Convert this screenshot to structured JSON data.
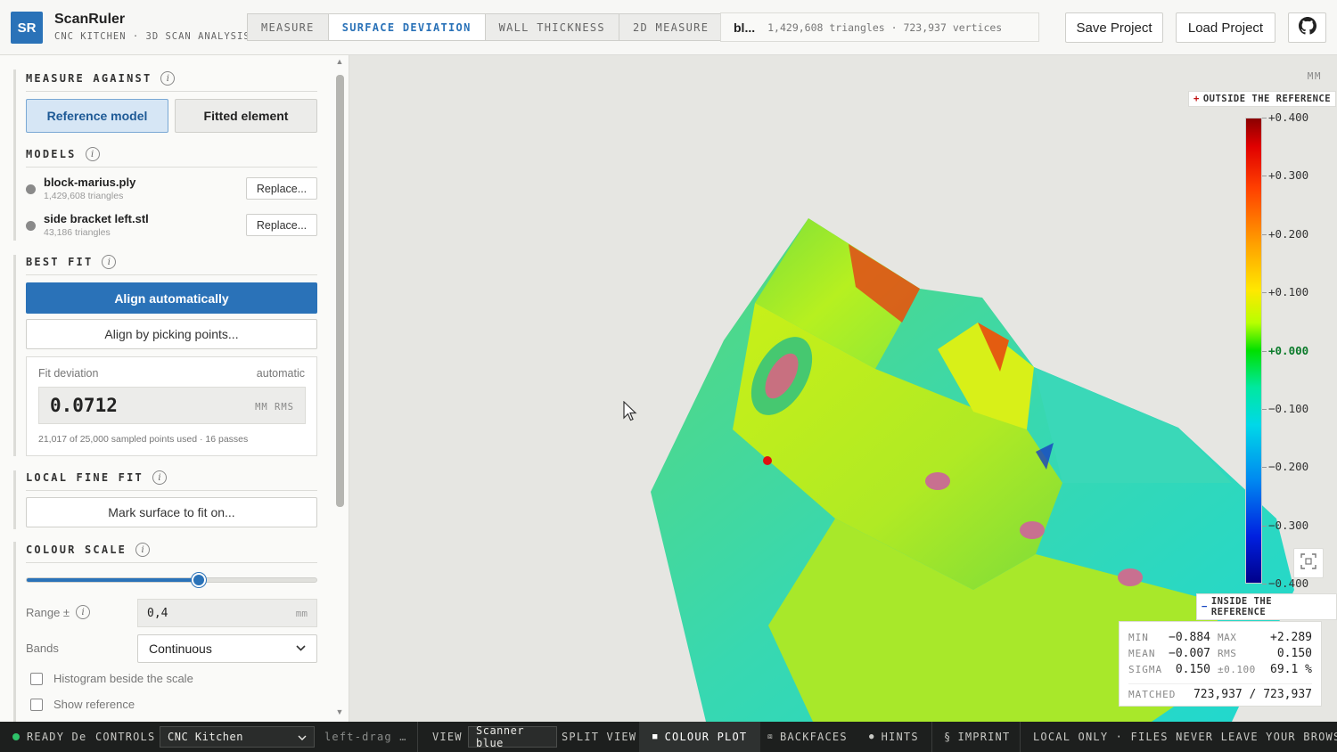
{
  "app": {
    "logo": "SR",
    "name": "ScanRuler",
    "subtitle": "CNC KITCHEN · 3D SCAN ANALYSIS"
  },
  "tabs": [
    {
      "label": "MEASURE"
    },
    {
      "label": "SURFACE DEVIATION"
    },
    {
      "label": "WALL THICKNESS"
    },
    {
      "label": "2D MEASURE"
    }
  ],
  "file_info": {
    "name": "bl...",
    "stats": "1,429,608 triangles · 723,937 vertices"
  },
  "header_buttons": {
    "save": "Save Project",
    "load": "Load Project",
    "github_icon": "github-icon"
  },
  "sidebar": {
    "measure_against": {
      "title": "MEASURE AGAINST",
      "options": [
        "Reference model",
        "Fitted element"
      ],
      "selected": "Reference model"
    },
    "models": {
      "title": "MODELS",
      "items": [
        {
          "name": "block-marius.ply",
          "triangles": "1,429,608 triangles",
          "button": "Replace..."
        },
        {
          "name": "side bracket left.stl",
          "triangles": "43,186 triangles",
          "button": "Replace..."
        }
      ]
    },
    "best_fit": {
      "title": "BEST FIT",
      "auto_button": "Align automatically",
      "pick_button": "Align by picking points...",
      "fit_label": "Fit deviation",
      "fit_mode": "automatic",
      "fit_value": "0.0712",
      "fit_unit": "MM RMS",
      "fit_note": "21,017 of 25,000 sampled points used · 16 passes"
    },
    "local_fine_fit": {
      "title": "LOCAL FINE FIT",
      "button": "Mark surface to fit on..."
    },
    "colour_scale": {
      "title": "COLOUR SCALE",
      "slider_fraction": 0.59,
      "range_label": "Range ±",
      "range_value": "0,4",
      "range_unit": "mm",
      "bands_label": "Bands",
      "bands_value": "Continuous",
      "histogram_label": "Histogram beside the scale",
      "histogram_checked": false,
      "show_reference_label": "Show reference",
      "show_reference_checked": false
    }
  },
  "viewport": {
    "unit": "MM",
    "outside_label": "OUTSIDE THE REFERENCE",
    "inside_label": "INSIDE THE REFERENCE",
    "ticks": [
      "+0.400",
      "+0.300",
      "+0.200",
      "+0.100",
      "+0.000",
      "−0.100",
      "−0.200",
      "−0.300",
      "−0.400"
    ],
    "colors": {
      "max": "#8b0000",
      "zero": "#00e000",
      "min": "#00008a"
    },
    "stats": {
      "min_label": "MIN",
      "min": "−0.884",
      "max_label": "MAX",
      "max": "+2.289",
      "mean_label": "MEAN",
      "mean": "−0.007",
      "rms_label": "RMS",
      "rms": "0.150",
      "sigma_label": "SIGMA",
      "sigma": "0.150",
      "within_label": "±0.100",
      "within": "69.1 %",
      "matched_label": "MATCHED",
      "matched": "723,937 / 723,937"
    }
  },
  "statusbar": {
    "ready": "READY De",
    "controls_label": "CONTROLS",
    "controls_value": "CNC Kitchen",
    "hint": "left-drag …",
    "view_label": "VIEW",
    "view_value": "Scanner blue",
    "split_view": "SPLIT VIEW",
    "colour_plot": "COLOUR PLOT",
    "backfaces": "BACKFACES",
    "hints": "HINTS",
    "imprint": "IMPRINT",
    "privacy": "LOCAL ONLY · FILES NEVER LEAVE YOUR BROWSER"
  }
}
